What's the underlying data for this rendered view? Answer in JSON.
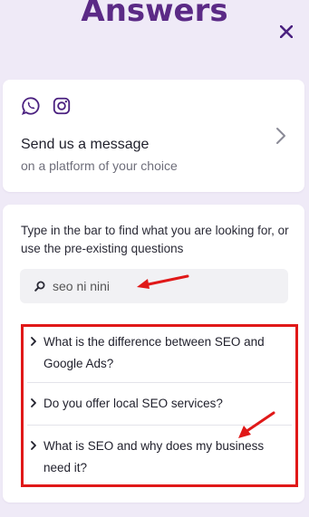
{
  "header": {
    "title": "Answers",
    "close_icon": "close-icon"
  },
  "message_card": {
    "icons": [
      "whatsapp-icon",
      "instagram-icon"
    ],
    "title": "Send us a message",
    "subtitle": "on a platform of your choice"
  },
  "search_card": {
    "instructions": "Type in the bar to find what you are looking for, or use the pre-existing questions",
    "search": {
      "value": "seo ni nini",
      "placeholder": ""
    },
    "questions": [
      {
        "label": "What is the difference between SEO and Google Ads?"
      },
      {
        "label": "Do you offer local SEO services?"
      },
      {
        "label": "What is SEO and why does my business need it?"
      }
    ]
  },
  "colors": {
    "accent": "#5b2a86",
    "background": "#efeaf7",
    "annotation": "#e01818"
  }
}
